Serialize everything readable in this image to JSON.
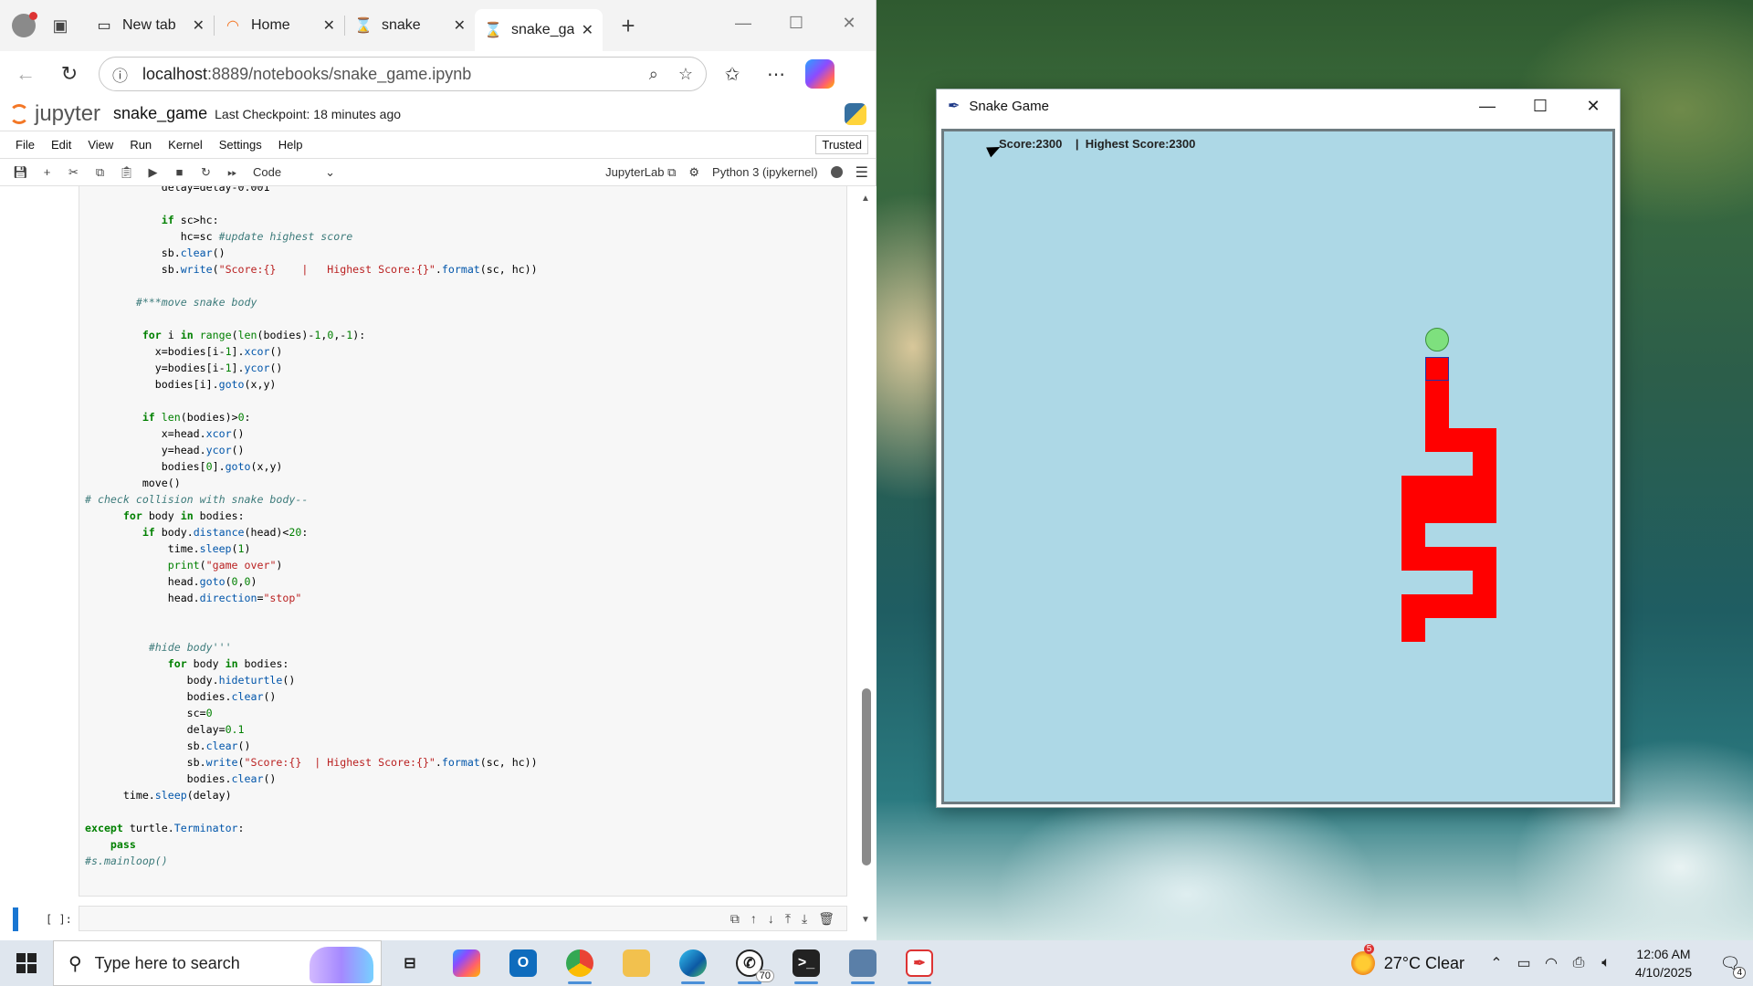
{
  "browser": {
    "tabs": [
      {
        "label": "New tab",
        "icon": "new-tab-icon"
      },
      {
        "label": "Home",
        "icon": "jupyter-icon"
      },
      {
        "label": "snake",
        "icon": "hourglass-icon"
      },
      {
        "label": "snake_gam",
        "icon": "hourglass-icon",
        "active": true
      }
    ],
    "url_host": "localhost",
    "url_path": ":8889/notebooks/snake_game.ipynb"
  },
  "jupyter": {
    "logo_text": "jupyter",
    "notebook_title": "snake_game",
    "checkpoint": "Last Checkpoint: 18 minutes ago",
    "menu": [
      "File",
      "Edit",
      "View",
      "Run",
      "Kernel",
      "Settings",
      "Help"
    ],
    "trusted": "Trusted",
    "cell_type": "Code",
    "jupyterlab_link": "JupyterLab",
    "kernel_name": "Python 3 (ipykernel)",
    "empty_prompt": "[ ]:"
  },
  "snake_window": {
    "title": "Snake Game",
    "score_text": "Score:2300    |  Highest Score:2300",
    "canvas_color": "#add8e6",
    "snake_color": "#ff0000",
    "food_color": "#7ee07e"
  },
  "taskbar": {
    "search_placeholder": "Type here to search",
    "whatsapp_badge": "70",
    "weather_badge": "5",
    "weather": "27°C  Clear",
    "time": "12:06 AM",
    "date": "4/10/2025",
    "notification_count": "4"
  }
}
